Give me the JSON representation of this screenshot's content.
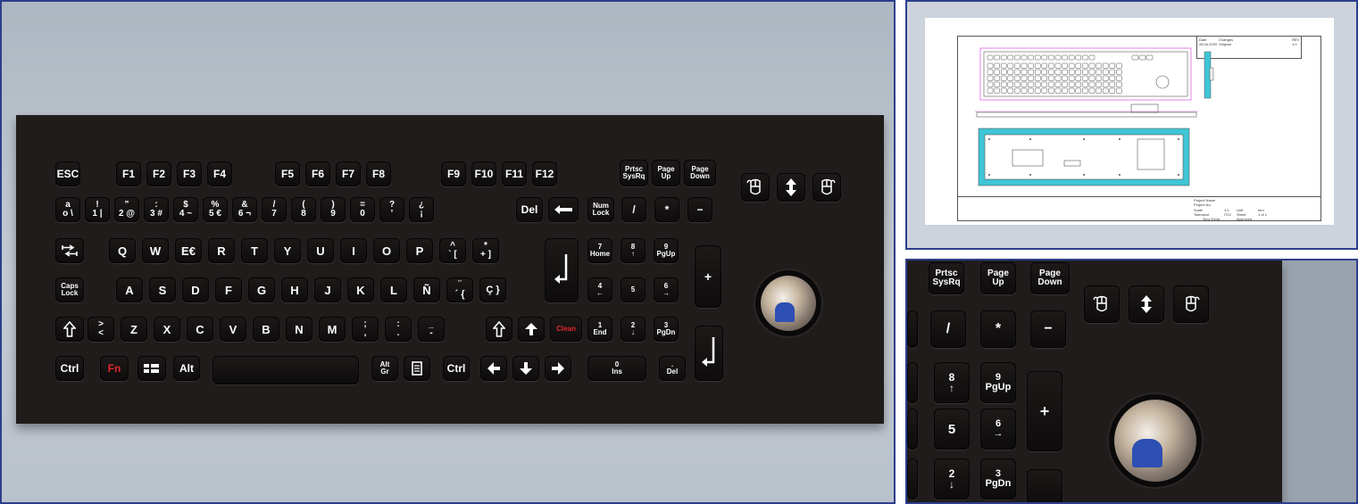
{
  "photo": {
    "keys": {
      "esc": "ESC",
      "f1": "F1",
      "f2": "F2",
      "f3": "F3",
      "f4": "F4",
      "f5": "F5",
      "f6": "F6",
      "f7": "F7",
      "f8": "F8",
      "f9": "F9",
      "f10": "F10",
      "f11": "F11",
      "f12": "F12",
      "prtsc": "Prtsc\nSysRq",
      "pageup": "Page\nUp",
      "pagedown": "Page\nDown",
      "row1": [
        "a\no \\",
        "!\n1 |",
        "\"\n2 @",
        ":\n3 #",
        "$\n4 ~",
        "%\n5 €",
        "&\n6 ¬",
        "/\n7",
        "(\n8",
        ")\n9",
        "=\n0",
        "?\n'",
        "¿\n¡"
      ],
      "del": "Del",
      "numlock": "Num\nLock",
      "num_row1": [
        "/",
        "*",
        "−"
      ],
      "row2": [
        "Q",
        "W",
        "E€",
        "R",
        "T",
        "Y",
        "U",
        "I",
        "O",
        "P",
        "^\n` [",
        "*\n+ ]"
      ],
      "num_row2": [
        "7\nHome",
        "8\n↑",
        "9\nPgUp"
      ],
      "plus": "+",
      "caps": "Caps\nLock",
      "row3": [
        "A",
        "S",
        "D",
        "F",
        "G",
        "H",
        "J",
        "K",
        "L",
        "Ñ",
        "¨\n´ {",
        "Ç }"
      ],
      "num_row3": [
        "4\n←",
        "5",
        "6\n→"
      ],
      "row4": [
        ">\n<",
        "Z",
        "X",
        "C",
        "V",
        "B",
        "N",
        "M",
        ";\n,",
        ":\n.",
        "_\n-"
      ],
      "clean": "Clean",
      "num_row4": [
        "1\nEnd",
        "2\n↓",
        "3\nPgDn"
      ],
      "ctrl": "Ctrl",
      "fn": "Fn",
      "alt": "Alt",
      "altgr": "Alt\nGr",
      "num0": "0\nIns",
      "numdel": ".\nDel"
    }
  },
  "drawing": {
    "title_block": {
      "date_label": "Date",
      "changes_label": "Changes",
      "rev_label": "REV",
      "date_value": "28.04.2020",
      "change_value": "Original",
      "rev_value": "1.0",
      "project_name": "Project Name",
      "project_no": "Project No.",
      "scale_label": "Scale",
      "scale_value": "1:1",
      "unit_label": "Unit",
      "unit_value": "mm",
      "tolerance_label": "Tolerance",
      "tolerance_value": "IT12",
      "sheet_label": "Sheet",
      "sheet_value": "1 of 1",
      "drawn_by": "Tony Deng",
      "approved_label": "Approved"
    }
  },
  "zoom": {
    "keys": [
      "Prtsc\nSysRq",
      "Page\nUp",
      "Page\nDown",
      "/",
      "*",
      "−",
      "8\n↑",
      "9\nPgUp",
      "+",
      "5",
      "6\n→",
      "2\n↓",
      "3\nPgDn"
    ]
  },
  "colors": {
    "frame": "#2d3e8c",
    "keyboard": "#1f1c1b",
    "key_red": "#e3262b",
    "cad_cyan": "#3fc6d6",
    "cad_magenta": "#d94fd9"
  }
}
